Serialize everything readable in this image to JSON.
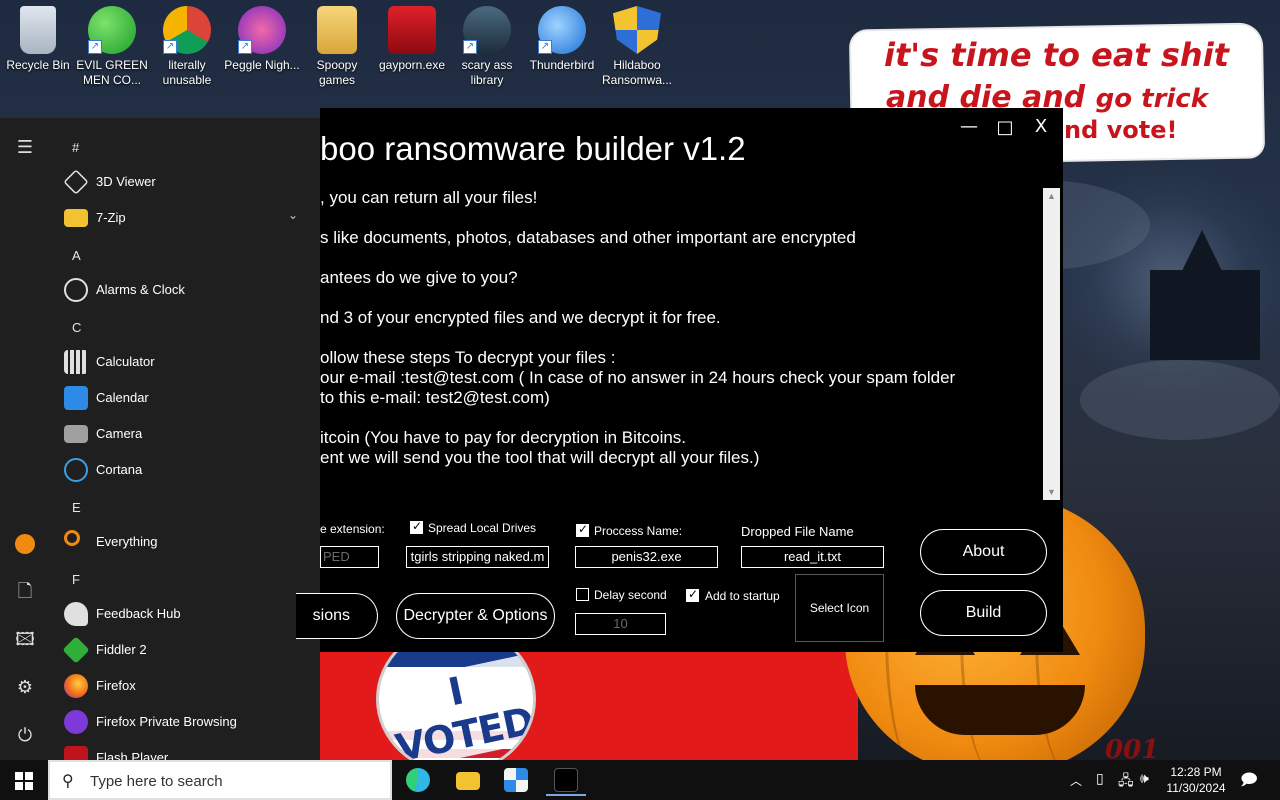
{
  "desktop": {
    "icons": [
      {
        "label": "Recycle Bin",
        "icon": "recycle-bin-icon",
        "shortcut": false
      },
      {
        "label": "EVIL GREEN MEN CO...",
        "icon": "green-men-icon",
        "shortcut": true
      },
      {
        "label": "literally unusable",
        "icon": "chrome-icon",
        "shortcut": true
      },
      {
        "label": "Peggle Nigh...",
        "icon": "peggle-icon",
        "shortcut": true
      },
      {
        "label": "Spoopy games",
        "icon": "folder-icon",
        "shortcut": false
      },
      {
        "label": "gayporn.exe",
        "icon": "flash-icon",
        "shortcut": false
      },
      {
        "label": "scary ass library",
        "icon": "library-icon",
        "shortcut": true
      },
      {
        "label": "Thunderbird",
        "icon": "thunderbird-icon",
        "shortcut": true
      },
      {
        "label": "Hildaboo Ransomwa...",
        "icon": "shield-icon",
        "shortcut": false
      }
    ],
    "note": {
      "line1": "it's time to eat shit",
      "line2a": "and die and",
      "line2b": "go trick",
      "line3": "nd vote!"
    },
    "sticker_text": "I VOTED",
    "corner_text": "001"
  },
  "start_menu": {
    "rail": [
      "hamburger-menu-icon",
      "user-avatar-icon",
      "documents-icon",
      "pictures-icon",
      "settings-icon",
      "power-icon"
    ],
    "sections": [
      {
        "letter": "#",
        "apps": [
          {
            "label": "3D Viewer",
            "icon": "cube-icon",
            "color": "#e0e0e0"
          },
          {
            "label": "7-Zip",
            "icon": "folder-icon",
            "color": "#f2c230",
            "expandable": true
          }
        ]
      },
      {
        "letter": "A",
        "apps": [
          {
            "label": "Alarms & Clock",
            "icon": "clock-icon",
            "color": "#e0e0e0"
          }
        ]
      },
      {
        "letter": "C",
        "apps": [
          {
            "label": "Calculator",
            "icon": "calculator-icon",
            "color": "#e0e0e0"
          },
          {
            "label": "Calendar",
            "icon": "calendar-icon",
            "color": "#2d8ae6"
          },
          {
            "label": "Camera",
            "icon": "camera-icon",
            "color": "#a0a0a0"
          },
          {
            "label": "Cortana",
            "icon": "cortana-icon",
            "color": "#3aa0e6"
          }
        ]
      },
      {
        "letter": "E",
        "apps": [
          {
            "label": "Everything",
            "icon": "search-icon",
            "color": "#f08a10"
          }
        ]
      },
      {
        "letter": "F",
        "apps": [
          {
            "label": "Feedback Hub",
            "icon": "feedback-icon",
            "color": "#e0e0e0"
          },
          {
            "label": "Fiddler 2",
            "icon": "fiddler-icon",
            "color": "#2fae3a"
          },
          {
            "label": "Firefox",
            "icon": "firefox-icon",
            "color": "#f26a1b"
          },
          {
            "label": "Firefox Private Browsing",
            "icon": "private-mask-icon",
            "color": "#7d3ad8"
          },
          {
            "label": "Flash Player",
            "icon": "flash-icon",
            "color": "#c0141c"
          }
        ]
      }
    ]
  },
  "builder": {
    "title": "boo ransomware builder v1.2",
    "controls": {
      "minimize": "—",
      "maximize": "□",
      "close": "X"
    },
    "message_lines": [
      ", you can return all your files!",
      "s like documents, photos, databases and other important are encrypted",
      "antees do we give to you?",
      "nd 3 of your encrypted files and we decrypt it for free.",
      "ollow these steps To decrypt your files :",
      "our e-mail :test@test.com ( In case of no answer in 24 hours check your spam folder",
      "to this e-mail: test2@test.com)",
      "itcoin (You have to pay for decryption in Bitcoins.",
      "ent we will send you the tool that will decrypt all your files.)"
    ],
    "options": {
      "extension_label": "e extension:",
      "extension_value": "PED",
      "spread_label": "Spread Local Drives",
      "spread_checked": true,
      "spread_value": "tgirls stripping naked.m",
      "process_label": "Proccess Name:",
      "process_checked": true,
      "process_value": "penis32.exe",
      "dropped_label": "Dropped File Name",
      "dropped_value": "read_it.txt",
      "delay_label": "Delay second",
      "delay_checked": false,
      "delay_value": "10",
      "startup_label": "Add to startup",
      "startup_checked": true,
      "select_icon_label": "Select Icon"
    },
    "buttons": {
      "extensions": "sions",
      "decrypter": "Decrypter & Options",
      "about": "About",
      "build": "Build"
    }
  },
  "taskbar": {
    "search_placeholder": "Type here to search",
    "pinned": [
      "edge-icon",
      "file-explorer-icon",
      "store-icon",
      "builder-app-icon"
    ],
    "time": "12:28 PM",
    "date": "11/30/2024"
  }
}
